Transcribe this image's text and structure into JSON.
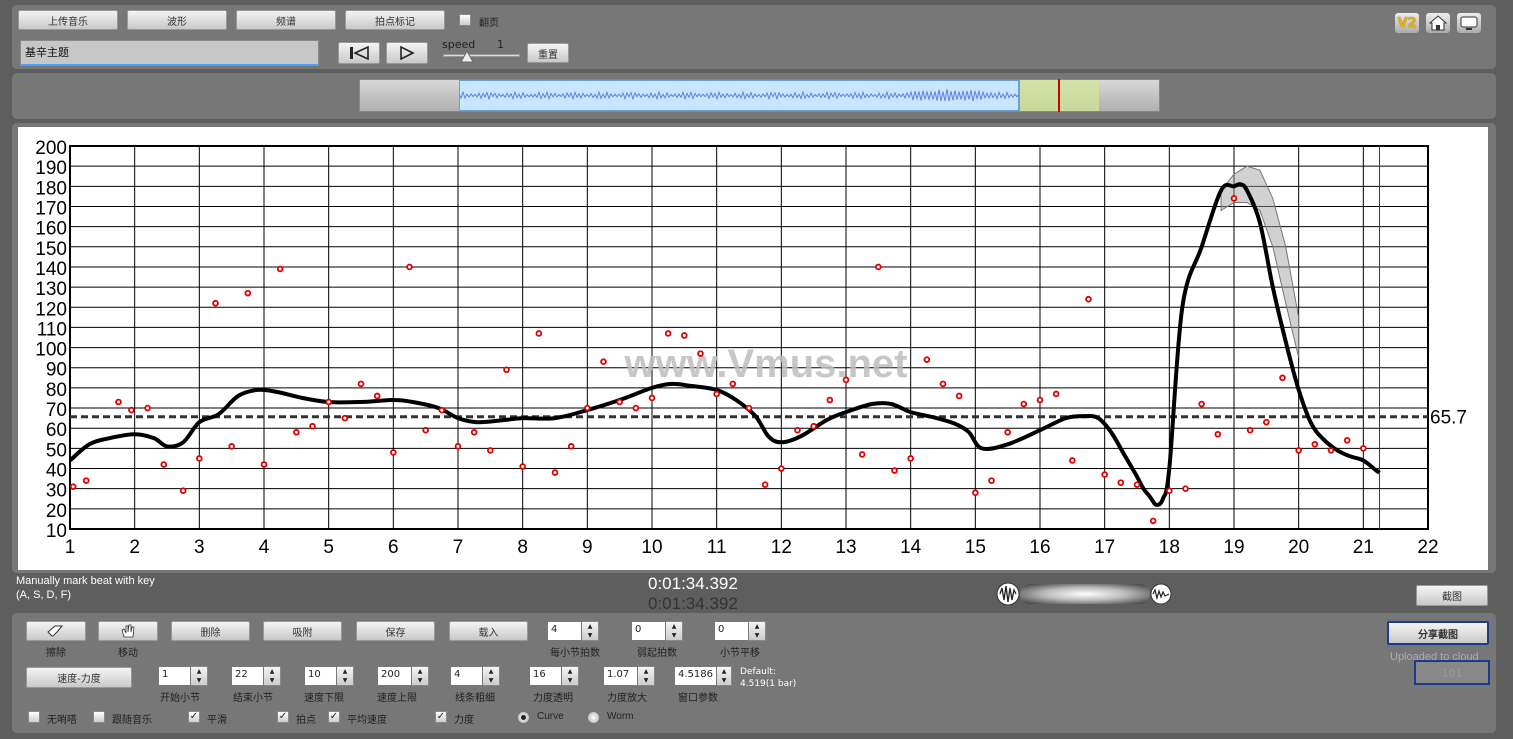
{
  "toolbar": {
    "upload_label": "上传音乐",
    "waveform_label": "波形",
    "spectrum_label": "频谱",
    "beatmark_label": "拍点标记",
    "flip_label": "翻页",
    "title_value": "基辛主题",
    "speed_label": "speed",
    "speed_value": "1",
    "reset_label": "重置",
    "version_badge": "V2"
  },
  "chart_data": {
    "type": "line",
    "x_ticks": [
      "1",
      "2",
      "3",
      "4",
      "5",
      "6",
      "7",
      "8",
      "9",
      "10",
      "11",
      "12",
      "13",
      "14",
      "15",
      "16",
      "17",
      "18",
      "19",
      "20",
      "21",
      "22"
    ],
    "y_ticks": [
      "10",
      "20",
      "30",
      "40",
      "50",
      "60",
      "70",
      "80",
      "90",
      "100",
      "110",
      "120",
      "130",
      "140",
      "150",
      "160",
      "170",
      "180",
      "190",
      "200"
    ],
    "xlim": [
      1,
      22
    ],
    "ylim": [
      10,
      200
    ],
    "grid": true,
    "average": 65.7,
    "average_label": "65.7",
    "watermark": "www.Vmus.net",
    "cursor_x": 21.25,
    "series": [
      {
        "x": [
          1,
          1.3,
          1.6,
          2.0,
          2.3,
          2.5,
          2.75,
          3.0,
          3.3,
          3.6,
          3.9,
          4.2,
          4.6,
          5.0,
          5.5,
          6.0,
          6.3,
          6.7,
          7.0,
          7.3,
          7.7,
          8.0,
          8.5,
          9.0,
          9.5,
          10.0,
          10.3,
          10.6,
          11.0,
          11.3,
          11.6,
          11.8,
          12.0,
          12.3,
          12.7,
          13.0,
          13.4,
          13.7,
          14.0,
          14.4,
          14.7,
          14.9,
          15.1,
          15.5,
          16.0,
          16.4,
          16.7,
          16.9,
          17.1,
          17.3,
          17.5,
          17.6,
          17.7,
          17.8,
          17.9,
          18.0,
          18.2,
          18.5,
          18.8,
          19.0,
          19.1,
          19.2,
          19.4,
          19.6,
          19.8,
          20.0,
          20.2,
          20.4,
          20.6,
          20.8,
          21.0,
          21.2,
          21.25
        ],
        "y": [
          44,
          52,
          55,
          57,
          55,
          51,
          53,
          63,
          67,
          76,
          79,
          78,
          75,
          73,
          73,
          74,
          73,
          70,
          65,
          63,
          64,
          65,
          65,
          69,
          74,
          80,
          82,
          81,
          79,
          74,
          66,
          56,
          53,
          56,
          64,
          68,
          72,
          72,
          68,
          65,
          62,
          58,
          50,
          52,
          59,
          65,
          66,
          65,
          58,
          47,
          36,
          30,
          26,
          22,
          25,
          40,
          120,
          150,
          178,
          180,
          181,
          178,
          162,
          130,
          103,
          79,
          62,
          54,
          49,
          46,
          44,
          39,
          38
        ],
        "band_upper": [
          178,
          186,
          190,
          188,
          174,
          150,
          115
        ],
        "band_lower": [
          168,
          172,
          172,
          168,
          150,
          122,
          95
        ],
        "band_x": [
          18.8,
          19.0,
          19.2,
          19.4,
          19.6,
          19.8,
          20.0
        ]
      }
    ],
    "points": [
      [
        1.05,
        31
      ],
      [
        1.25,
        34
      ],
      [
        1.75,
        73
      ],
      [
        1.95,
        69
      ],
      [
        2.2,
        70
      ],
      [
        2.45,
        42
      ],
      [
        2.75,
        29
      ],
      [
        3.0,
        45
      ],
      [
        3.25,
        122
      ],
      [
        3.5,
        51
      ],
      [
        3.75,
        127
      ],
      [
        4.0,
        42
      ],
      [
        4.25,
        139
      ],
      [
        4.5,
        58
      ],
      [
        4.75,
        61
      ],
      [
        5.0,
        73
      ],
      [
        5.25,
        65
      ],
      [
        5.5,
        82
      ],
      [
        5.75,
        76
      ],
      [
        6.0,
        48
      ],
      [
        6.25,
        140
      ],
      [
        6.5,
        59
      ],
      [
        6.75,
        69
      ],
      [
        7.0,
        51
      ],
      [
        7.25,
        58
      ],
      [
        7.5,
        49
      ],
      [
        7.75,
        89
      ],
      [
        8.0,
        41
      ],
      [
        8.25,
        107
      ],
      [
        8.5,
        38
      ],
      [
        8.75,
        51
      ],
      [
        9.0,
        70
      ],
      [
        9.25,
        93
      ],
      [
        9.5,
        73
      ],
      [
        9.75,
        70
      ],
      [
        10.0,
        75
      ],
      [
        10.25,
        107
      ],
      [
        10.5,
        106
      ],
      [
        10.75,
        97
      ],
      [
        11.0,
        77
      ],
      [
        11.25,
        82
      ],
      [
        11.5,
        70
      ],
      [
        11.75,
        32
      ],
      [
        12.0,
        40
      ],
      [
        12.25,
        59
      ],
      [
        12.5,
        61
      ],
      [
        12.75,
        74
      ],
      [
        13.0,
        84
      ],
      [
        13.25,
        47
      ],
      [
        13.5,
        140
      ],
      [
        13.75,
        39
      ],
      [
        14.0,
        45
      ],
      [
        14.25,
        94
      ],
      [
        14.5,
        82
      ],
      [
        14.75,
        76
      ],
      [
        15.0,
        28
      ],
      [
        15.25,
        34
      ],
      [
        15.5,
        58
      ],
      [
        15.75,
        72
      ],
      [
        16.0,
        74
      ],
      [
        16.25,
        77
      ],
      [
        16.5,
        44
      ],
      [
        16.75,
        124
      ],
      [
        17.0,
        37
      ],
      [
        17.25,
        33
      ],
      [
        17.5,
        32
      ],
      [
        17.75,
        14
      ],
      [
        18.0,
        29
      ],
      [
        18.25,
        30
      ],
      [
        18.5,
        72
      ],
      [
        18.75,
        57
      ],
      [
        19.0,
        174
      ],
      [
        19.25,
        59
      ],
      [
        19.5,
        63
      ],
      [
        19.75,
        85
      ],
      [
        20.0,
        49
      ],
      [
        20.25,
        52
      ],
      [
        20.5,
        49
      ],
      [
        20.75,
        54
      ],
      [
        21.0,
        50
      ]
    ]
  },
  "status": {
    "hint_line1": "Manually mark beat with key",
    "hint_line2": "(A, S, D, F)",
    "time_current": "0:01:34.392",
    "time_total": "0:01:34.392",
    "screenshot_label": "截图"
  },
  "controls": {
    "erase_label": "擦除",
    "move_label": "移动",
    "delete_label": "删除",
    "snap_label": "吸附",
    "save_label": "保存",
    "load_label": "载入",
    "beats_per_bar_value": "4",
    "beats_per_bar_label": "每小节拍数",
    "pickup_value": "0",
    "pickup_label": "弱起拍数",
    "bar_shift_value": "0",
    "bar_shift_label": "小节平移",
    "mode_label": "速度-力度",
    "start_bar_value": "1",
    "start_bar_label": "开始小节",
    "end_bar_value": "22",
    "end_bar_label": "结束小节",
    "tempo_min_value": "10",
    "tempo_min_label": "速度下限",
    "tempo_max_value": "200",
    "tempo_max_label": "速度上限",
    "line_width_value": "4",
    "line_width_label": "线条粗细",
    "dyn_alpha_value": "16",
    "dyn_alpha_label": "力度透明",
    "dyn_scale_value": "1.07",
    "dyn_scale_label": "力度放大",
    "window_value": "4.5186",
    "window_label": "窗口参数",
    "default_line1": "Default:",
    "default_line2": "4.519(1 bar)",
    "share_label": "分享截图",
    "uploaded_label": "Uploaded to cloud",
    "cloud_value": "101",
    "no_beats_label": "无哨嗒",
    "follow_music_label": "跟随音乐",
    "smooth_label": "平滑",
    "beat_points_label": "拍点",
    "avg_tempo_label": "平均速度",
    "dynamics_label": "力度",
    "curve_label": "Curve",
    "worm_label": "Worm"
  }
}
